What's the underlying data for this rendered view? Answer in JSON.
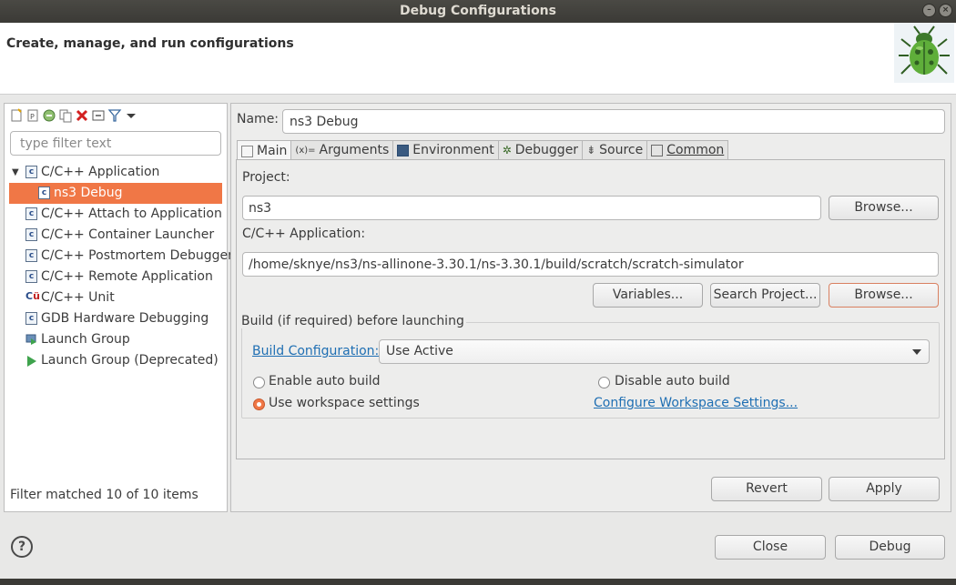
{
  "window": {
    "title": "Debug Configurations",
    "subtitle": "Create, manage, and run configurations"
  },
  "left": {
    "filter_placeholder": "type filter text",
    "tree": [
      {
        "label": "C/C++ Application",
        "icon": "c-app-icon",
        "expanded": true
      },
      {
        "label": "ns3 Debug",
        "icon": "c-app-icon",
        "selected": true
      },
      {
        "label": "C/C++ Attach to Application",
        "icon": "c-app-icon"
      },
      {
        "label": "C/C++ Container Launcher",
        "icon": "c-app-icon"
      },
      {
        "label": "C/C++ Postmortem Debugger",
        "icon": "c-app-icon"
      },
      {
        "label": "C/C++ Remote Application",
        "icon": "c-app-icon"
      },
      {
        "label": "C/C++ Unit",
        "icon": "c-unit-icon"
      },
      {
        "label": "GDB Hardware Debugging",
        "icon": "c-app-icon"
      },
      {
        "label": "Launch Group",
        "icon": "launch-group-icon"
      },
      {
        "label": "Launch Group (Deprecated)",
        "icon": "play-icon"
      }
    ],
    "status": "Filter matched 10 of 10 items"
  },
  "right": {
    "name_label": "Name:",
    "name_value": "ns3 Debug",
    "tabs": [
      {
        "label": "Main",
        "active": true
      },
      {
        "label": "Arguments"
      },
      {
        "label": "Environment"
      },
      {
        "label": "Debugger"
      },
      {
        "label": "Source"
      },
      {
        "label": "Common"
      }
    ],
    "project_label": "Project:",
    "project_value": "ns3",
    "browse1": "Browse...",
    "app_label": "C/C++ Application:",
    "app_value": "/home/sknye/ns3/ns-allinone-3.30.1/ns-3.30.1/build/scratch/scratch-simulator",
    "variables": "Variables...",
    "search_project": "Search Project...",
    "browse2": "Browse...",
    "build_group_title": "Build (if required) before launching",
    "build_config_link": "Build Configuration:",
    "build_config_value": "Use Active",
    "enable_auto": "Enable auto build",
    "disable_auto": "Disable auto build",
    "use_workspace": "Use workspace settings",
    "configure_link": "Configure Workspace Settings...",
    "revert": "Revert",
    "apply": "Apply"
  },
  "footer": {
    "close": "Close",
    "debug": "Debug"
  },
  "colors": {
    "selection": "#f07746",
    "link": "#1f6fb3"
  }
}
